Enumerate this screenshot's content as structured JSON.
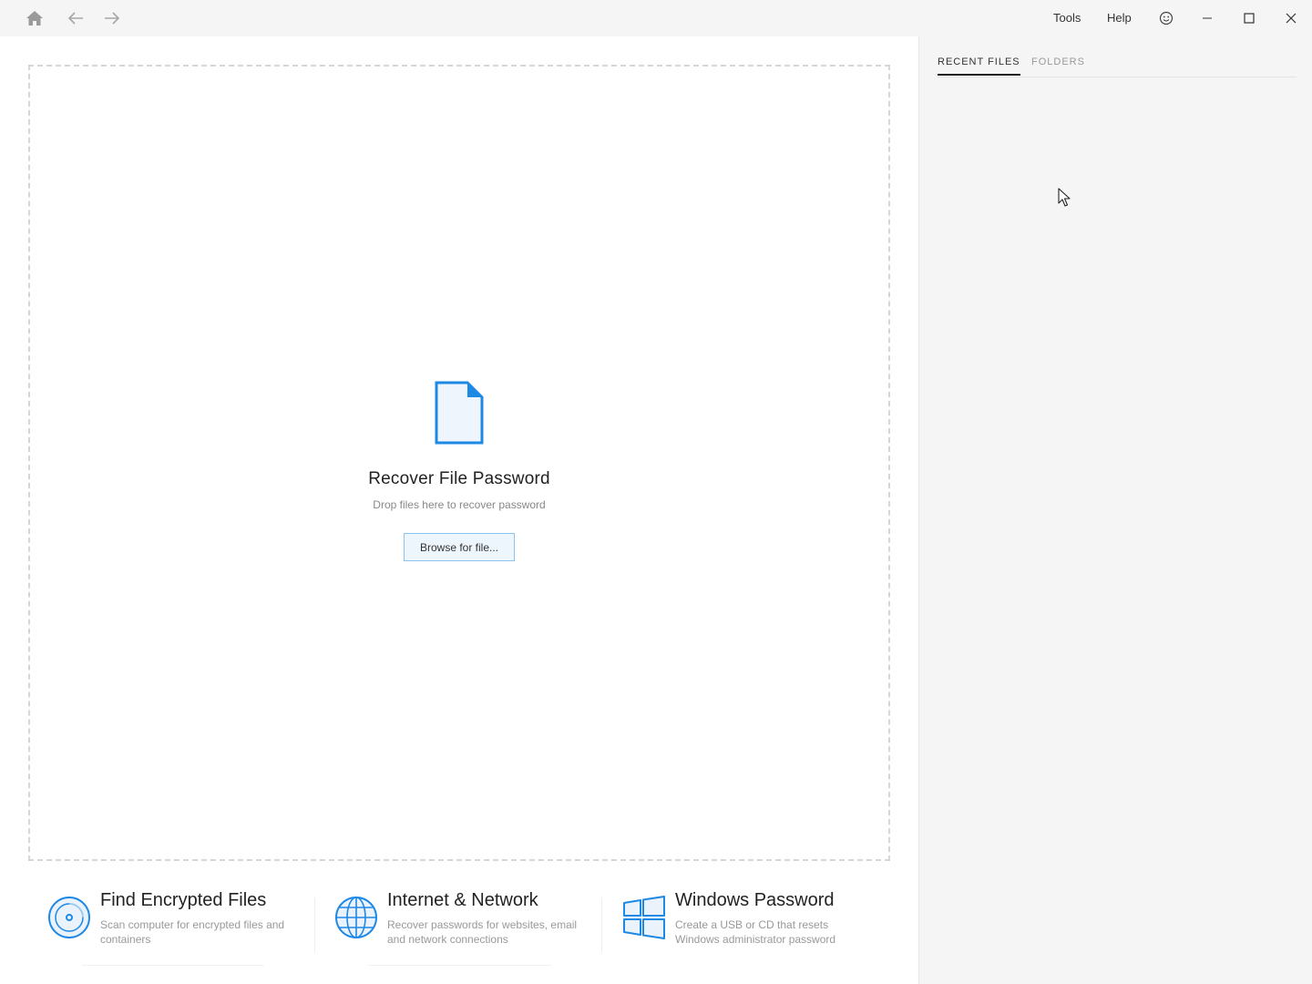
{
  "titlebar": {
    "menu": [
      "Tools",
      "Help"
    ],
    "icons": {
      "home": "home-icon",
      "back": "arrow-left-icon",
      "forward": "arrow-right-icon",
      "feedback": "smiley-icon",
      "minimize": "minimize-icon",
      "maximize": "maximize-icon",
      "close": "close-icon"
    }
  },
  "dropzone": {
    "icon": "document-icon",
    "title": "Recover File Password",
    "subtitle": "Drop files here to recover password",
    "browse_label": "Browse for file..."
  },
  "features": [
    {
      "icon": "disc-scan-icon",
      "title": "Find Encrypted Files",
      "description": "Scan computer for encrypted files and containers"
    },
    {
      "icon": "globe-icon",
      "title": "Internet & Network",
      "description": "Recover passwords for websites, email and network connections"
    },
    {
      "icon": "windows-logo-icon",
      "title": "Windows Password",
      "description": "Create a USB or CD that resets Windows administrator password"
    }
  ],
  "sidepanel": {
    "tabs": [
      {
        "label": "RECENT FILES",
        "active": true
      },
      {
        "label": "FOLDERS",
        "active": false
      }
    ]
  },
  "colors": {
    "accent": "#1e88e5",
    "titlebar_bg": "#f5f5f5",
    "sidepanel_bg": "#f5f5f5",
    "dashed_border": "#d6d6d6",
    "browse_border": "#8ec3ee",
    "browse_bg": "#eef6fd"
  }
}
